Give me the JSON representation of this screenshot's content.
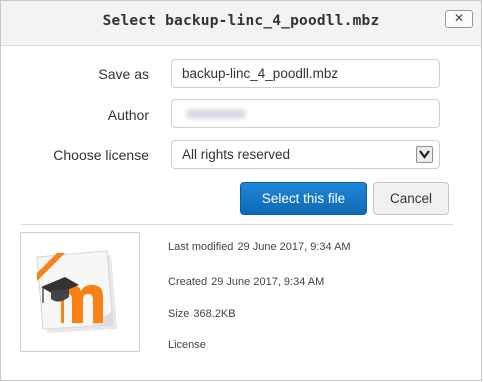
{
  "dialog": {
    "title": "Select backup-linc_4_poodll.mbz",
    "close_label": "✕"
  },
  "form": {
    "save_as_label": "Save as",
    "save_as_value": "backup-linc_4_poodll.mbz",
    "author_label": "Author",
    "license_label": "Choose license",
    "license_value": "All rights reserved"
  },
  "buttons": {
    "select_label": "Select this file",
    "cancel_label": "Cancel"
  },
  "file_info": {
    "last_modified_label": "Last modified",
    "last_modified_value": "29 June 2017, 9:34 AM",
    "created_label": "Created",
    "created_value": "29 June 2017, 9:34 AM",
    "size_label": "Size",
    "size_value": "368.2KB",
    "license_label": "License"
  },
  "icons": {
    "close": "close-icon",
    "dropdown": "chevron-down-icon",
    "file_thumbnail": "moodle-backup-file-icon"
  },
  "colors": {
    "primary": "#1279c9",
    "moodle_orange": "#f98012"
  }
}
